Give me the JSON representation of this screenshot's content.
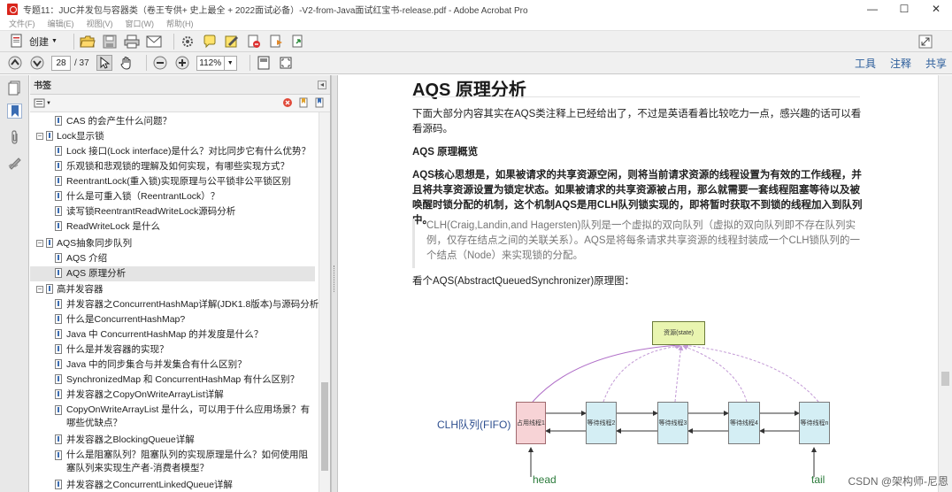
{
  "window": {
    "title": "专题11：JUC并发包与容器类（卷王专供+ 史上最全 + 2022面试必备）-V2-from-Java面试红宝书-release.pdf - Adobe Acrobat Pro",
    "controls": {
      "minimize": "—",
      "maximize": "☐",
      "close": "✕"
    }
  },
  "menu": [
    "文件(F)",
    "编辑(E)",
    "视图(V)",
    "窗口(W)",
    "帮助(H)"
  ],
  "toolbar": {
    "create_label": "创建",
    "page_current": "28",
    "page_total": "/ 37",
    "zoom": "112%",
    "right_tabs": [
      "工具",
      "注释",
      "共享"
    ]
  },
  "sidebar": {
    "panel_title": "书签",
    "items": [
      {
        "label": "CAS 的会产生什么问题？",
        "level": 2
      },
      {
        "label": "Lock显示锁",
        "level": 1,
        "expanded": true
      },
      {
        "label": "Lock 接口(Lock interface)是什么？对比同步它有什么优势？",
        "level": 2
      },
      {
        "label": "乐观锁和悲观锁的理解及如何实现，有哪些实现方式？",
        "level": 2
      },
      {
        "label": "ReentrantLock(重入锁)实现原理与公平锁非公平锁区别",
        "level": 2
      },
      {
        "label": "什么是可重入锁（ReentrantLock）？",
        "level": 2
      },
      {
        "label": "读写锁ReentrantReadWriteLock源码分析",
        "level": 2
      },
      {
        "label": "ReadWriteLock 是什么",
        "level": 2
      },
      {
        "label": "AQS抽象同步队列",
        "level": 1,
        "expanded": true
      },
      {
        "label": "AQS 介绍",
        "level": 2
      },
      {
        "label": "AQS 原理分析",
        "level": 2,
        "selected": true
      },
      {
        "label": "高并发容器",
        "level": 1,
        "expanded": true
      },
      {
        "label": "并发容器之ConcurrentHashMap详解(JDK1.8版本)与源码分析",
        "level": 2
      },
      {
        "label": "什么是ConcurrentHashMap?",
        "level": 2
      },
      {
        "label": "Java 中 ConcurrentHashMap 的并发度是什么？",
        "level": 2
      },
      {
        "label": "什么是并发容器的实现？",
        "level": 2
      },
      {
        "label": "Java 中的同步集合与并发集合有什么区别？",
        "level": 2
      },
      {
        "label": "SynchronizedMap 和 ConcurrentHashMap 有什么区别？",
        "level": 2
      },
      {
        "label": "并发容器之CopyOnWriteArrayList详解",
        "level": 2
      },
      {
        "label": "CopyOnWriteArrayList 是什么，可以用于什么应用场景？有哪些优缺点？",
        "level": 2
      },
      {
        "label": "并发容器之BlockingQueue详解",
        "level": 2
      },
      {
        "label": "什么是阻塞队列？阻塞队列的实现原理是什么？如何使用阻塞队列来实现生产者-消费者模型？",
        "level": 2
      },
      {
        "label": "并发容器之ConcurrentLinkedQueue详解",
        "level": 2
      }
    ]
  },
  "document": {
    "heading": "AQS 原理分析",
    "intro": "下面大部分内容其实在AQS类注释上已经给出了，不过是英语看着比较吃力一点，感兴趣的话可以看看源码。",
    "subheading": "AQS 原理概览",
    "core_idea": "AQS核心思想是，如果被请求的共享资源空闲，则将当前请求资源的线程设置为有效的工作线程，并且将共享资源设置为锁定状态。如果被请求的共享资源被占用，那么就需要一套线程阻塞等待以及被唤醒时锁分配的机制，这个机制AQS是用CLH队列锁实现的，即将暂时获取不到锁的线程加入到队列中。",
    "quote": "CLH(Craig,Landin,and Hagersten)队列是一个虚拟的双向队列（虚拟的双向队列即不存在队列实例，仅存在结点之间的关联关系）。AQS是将每条请求共享资源的线程封装成一个CLH锁队列的一个结点（Node）来实现锁的分配。",
    "diagram_intro": "看个AQS(AbstractQueuedSynchronizer)原理图：",
    "diagram": {
      "resource": "资源(state)",
      "queue_label": "CLH队列(FIFO)",
      "nodes": [
        "占用线程1",
        "等待线程2",
        "等待线程3",
        "等待线程4",
        "等待线程n"
      ],
      "head": "head",
      "tail": "tail"
    }
  },
  "watermark": "CSDN @架构师-尼恩",
  "colors": {
    "resource_fill": "#e9f5b0",
    "active_node_fill": "#f7d3d6",
    "waiting_node_fill": "#d4eef4",
    "link_color": "#2a5c9a",
    "dashed_arrow": "#c39ad6"
  }
}
